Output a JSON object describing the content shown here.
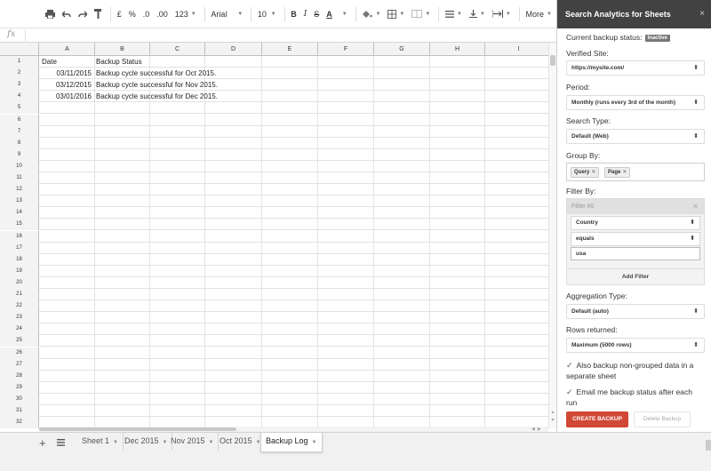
{
  "toolbar": {
    "currency": "£",
    "percent": "%",
    "decimal_less": ".0",
    "decimal_more": ".00",
    "number_format": "123",
    "font": "Arial",
    "font_size": "10",
    "bold": "B",
    "italic": "I",
    "strike": "S",
    "text_color": "A",
    "more": "More"
  },
  "formula_bar": {
    "fx": "fx"
  },
  "columns": [
    "A",
    "B",
    "C",
    "D",
    "E",
    "F",
    "G",
    "H",
    "I"
  ],
  "rows": [
    {
      "n": "1",
      "a": "Date",
      "b": "Backup Status"
    },
    {
      "n": "2",
      "a": "03/11/2015",
      "b": "Backup cycle successful for Oct 2015."
    },
    {
      "n": "3",
      "a": "03/12/2015",
      "b": "Backup cycle successful for Nov 2015."
    },
    {
      "n": "4",
      "a": "03/01/2016",
      "b": "Backup cycle successful for Dec 2015."
    },
    {
      "n": "5"
    },
    {
      "n": "6"
    },
    {
      "n": "7"
    },
    {
      "n": "8"
    },
    {
      "n": "9"
    },
    {
      "n": "10"
    },
    {
      "n": "11"
    },
    {
      "n": "12"
    },
    {
      "n": "13"
    },
    {
      "n": "14"
    },
    {
      "n": "15"
    },
    {
      "n": "16"
    },
    {
      "n": "17"
    },
    {
      "n": "18"
    },
    {
      "n": "19"
    },
    {
      "n": "20"
    },
    {
      "n": "21"
    },
    {
      "n": "22"
    },
    {
      "n": "23"
    },
    {
      "n": "24"
    },
    {
      "n": "25"
    },
    {
      "n": "26"
    },
    {
      "n": "27"
    },
    {
      "n": "28"
    },
    {
      "n": "29"
    },
    {
      "n": "30"
    },
    {
      "n": "31"
    },
    {
      "n": "32"
    }
  ],
  "sheet_tabs": [
    "Sheet 1",
    "Dec 2015",
    "Nov 2015",
    "Oct 2015",
    "Backup Log"
  ],
  "active_tab": "Backup Log",
  "sidebar": {
    "title": "Search Analytics for Sheets",
    "close": "×",
    "status_label": "Current backup status:",
    "status_badge": "Inactive",
    "verified_label": "Verified Site:",
    "verified_value": "https://mysite.com/",
    "period_label": "Period:",
    "period_value": "Monthly (runs every 3rd of the month)",
    "search_type_label": "Search Type:",
    "search_type_value": "Default (Web)",
    "group_by_label": "Group By:",
    "group_chips": [
      "Query",
      "Page"
    ],
    "filter_by_label": "Filter By:",
    "filter_title": "Filter #0",
    "filter_dimension": "Country",
    "filter_operator": "equals",
    "filter_value": "usa",
    "add_filter": "Add Filter",
    "aggregation_label": "Aggregation Type:",
    "aggregation_value": "Default (auto)",
    "rows_label": "Rows returned:",
    "rows_value": "Maximum (5000 rows)",
    "check1": "Also backup non-grouped data in a separate sheet",
    "check2": "Email me backup status after each run",
    "create_button": "CREATE BACKUP",
    "delete_button": "Delete Backup"
  },
  "colors": {
    "sidebar_header": "#424242",
    "create_button": "#d14836",
    "badge": "#777777"
  }
}
